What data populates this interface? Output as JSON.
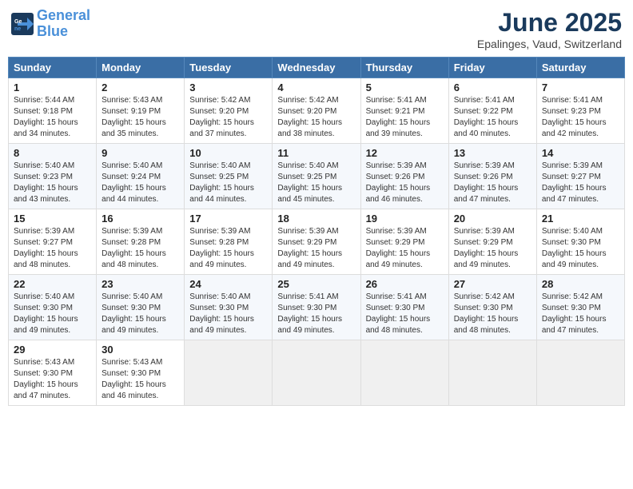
{
  "header": {
    "logo_line1": "General",
    "logo_line2": "Blue",
    "month": "June 2025",
    "location": "Epalinges, Vaud, Switzerland"
  },
  "weekdays": [
    "Sunday",
    "Monday",
    "Tuesday",
    "Wednesday",
    "Thursday",
    "Friday",
    "Saturday"
  ],
  "weeks": [
    [
      {
        "day": "1",
        "info": "Sunrise: 5:44 AM\nSunset: 9:18 PM\nDaylight: 15 hours\nand 34 minutes."
      },
      {
        "day": "2",
        "info": "Sunrise: 5:43 AM\nSunset: 9:19 PM\nDaylight: 15 hours\nand 35 minutes."
      },
      {
        "day": "3",
        "info": "Sunrise: 5:42 AM\nSunset: 9:20 PM\nDaylight: 15 hours\nand 37 minutes."
      },
      {
        "day": "4",
        "info": "Sunrise: 5:42 AM\nSunset: 9:20 PM\nDaylight: 15 hours\nand 38 minutes."
      },
      {
        "day": "5",
        "info": "Sunrise: 5:41 AM\nSunset: 9:21 PM\nDaylight: 15 hours\nand 39 minutes."
      },
      {
        "day": "6",
        "info": "Sunrise: 5:41 AM\nSunset: 9:22 PM\nDaylight: 15 hours\nand 40 minutes."
      },
      {
        "day": "7",
        "info": "Sunrise: 5:41 AM\nSunset: 9:23 PM\nDaylight: 15 hours\nand 42 minutes."
      }
    ],
    [
      {
        "day": "8",
        "info": "Sunrise: 5:40 AM\nSunset: 9:23 PM\nDaylight: 15 hours\nand 43 minutes."
      },
      {
        "day": "9",
        "info": "Sunrise: 5:40 AM\nSunset: 9:24 PM\nDaylight: 15 hours\nand 44 minutes."
      },
      {
        "day": "10",
        "info": "Sunrise: 5:40 AM\nSunset: 9:25 PM\nDaylight: 15 hours\nand 44 minutes."
      },
      {
        "day": "11",
        "info": "Sunrise: 5:40 AM\nSunset: 9:25 PM\nDaylight: 15 hours\nand 45 minutes."
      },
      {
        "day": "12",
        "info": "Sunrise: 5:39 AM\nSunset: 9:26 PM\nDaylight: 15 hours\nand 46 minutes."
      },
      {
        "day": "13",
        "info": "Sunrise: 5:39 AM\nSunset: 9:26 PM\nDaylight: 15 hours\nand 47 minutes."
      },
      {
        "day": "14",
        "info": "Sunrise: 5:39 AM\nSunset: 9:27 PM\nDaylight: 15 hours\nand 47 minutes."
      }
    ],
    [
      {
        "day": "15",
        "info": "Sunrise: 5:39 AM\nSunset: 9:27 PM\nDaylight: 15 hours\nand 48 minutes."
      },
      {
        "day": "16",
        "info": "Sunrise: 5:39 AM\nSunset: 9:28 PM\nDaylight: 15 hours\nand 48 minutes."
      },
      {
        "day": "17",
        "info": "Sunrise: 5:39 AM\nSunset: 9:28 PM\nDaylight: 15 hours\nand 49 minutes."
      },
      {
        "day": "18",
        "info": "Sunrise: 5:39 AM\nSunset: 9:29 PM\nDaylight: 15 hours\nand 49 minutes."
      },
      {
        "day": "19",
        "info": "Sunrise: 5:39 AM\nSunset: 9:29 PM\nDaylight: 15 hours\nand 49 minutes."
      },
      {
        "day": "20",
        "info": "Sunrise: 5:39 AM\nSunset: 9:29 PM\nDaylight: 15 hours\nand 49 minutes."
      },
      {
        "day": "21",
        "info": "Sunrise: 5:40 AM\nSunset: 9:30 PM\nDaylight: 15 hours\nand 49 minutes."
      }
    ],
    [
      {
        "day": "22",
        "info": "Sunrise: 5:40 AM\nSunset: 9:30 PM\nDaylight: 15 hours\nand 49 minutes."
      },
      {
        "day": "23",
        "info": "Sunrise: 5:40 AM\nSunset: 9:30 PM\nDaylight: 15 hours\nand 49 minutes."
      },
      {
        "day": "24",
        "info": "Sunrise: 5:40 AM\nSunset: 9:30 PM\nDaylight: 15 hours\nand 49 minutes."
      },
      {
        "day": "25",
        "info": "Sunrise: 5:41 AM\nSunset: 9:30 PM\nDaylight: 15 hours\nand 49 minutes."
      },
      {
        "day": "26",
        "info": "Sunrise: 5:41 AM\nSunset: 9:30 PM\nDaylight: 15 hours\nand 48 minutes."
      },
      {
        "day": "27",
        "info": "Sunrise: 5:42 AM\nSunset: 9:30 PM\nDaylight: 15 hours\nand 48 minutes."
      },
      {
        "day": "28",
        "info": "Sunrise: 5:42 AM\nSunset: 9:30 PM\nDaylight: 15 hours\nand 47 minutes."
      }
    ],
    [
      {
        "day": "29",
        "info": "Sunrise: 5:43 AM\nSunset: 9:30 PM\nDaylight: 15 hours\nand 47 minutes."
      },
      {
        "day": "30",
        "info": "Sunrise: 5:43 AM\nSunset: 9:30 PM\nDaylight: 15 hours\nand 46 minutes."
      },
      {
        "day": "",
        "info": ""
      },
      {
        "day": "",
        "info": ""
      },
      {
        "day": "",
        "info": ""
      },
      {
        "day": "",
        "info": ""
      },
      {
        "day": "",
        "info": ""
      }
    ]
  ]
}
